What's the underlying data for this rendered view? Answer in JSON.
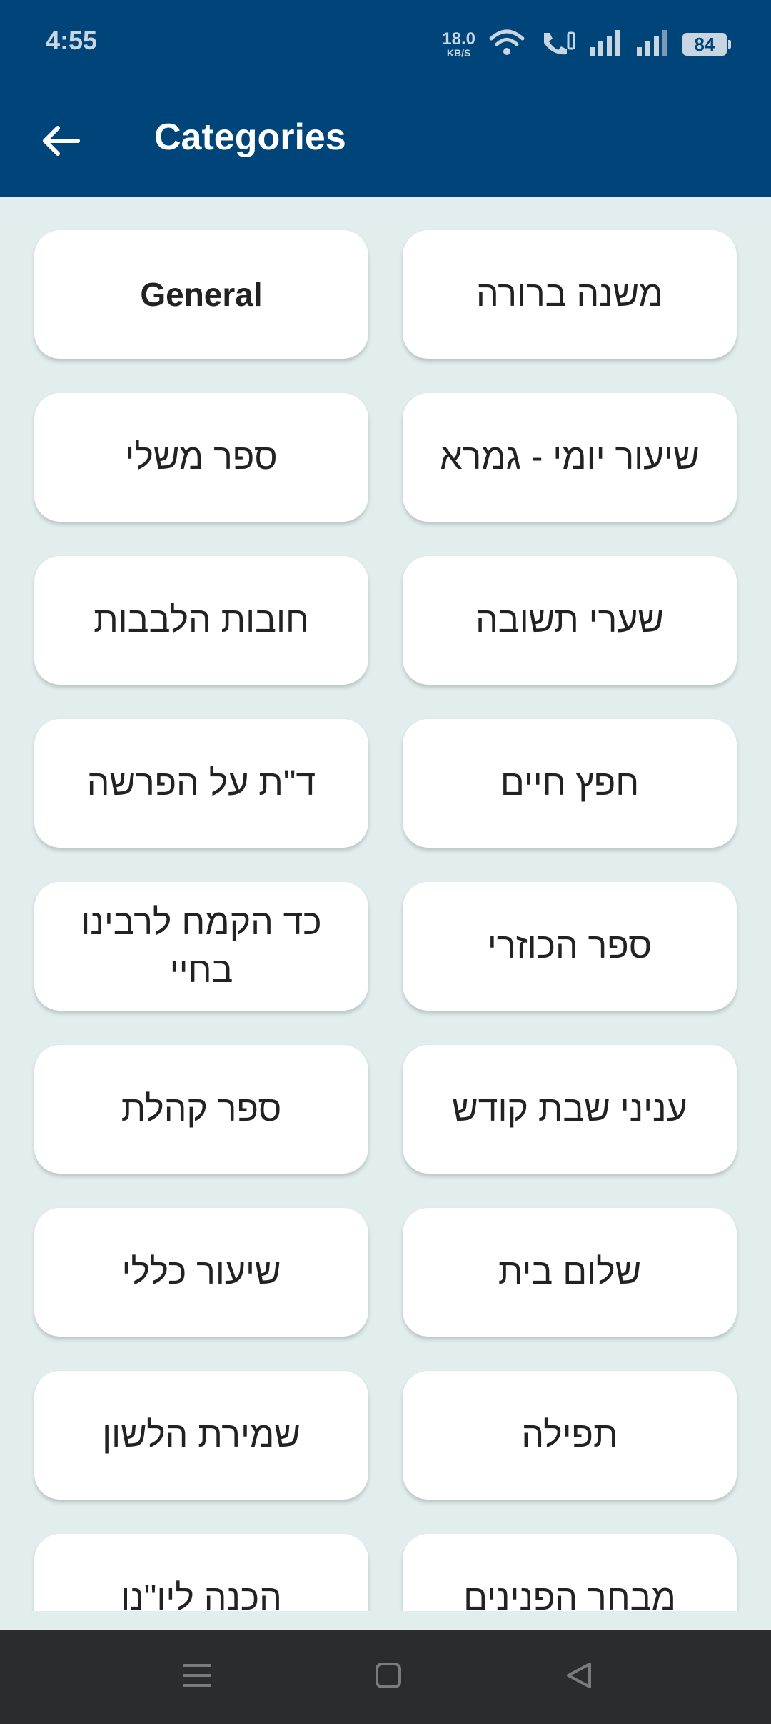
{
  "status_bar": {
    "time": "4:55",
    "net_speed_value": "18.0",
    "net_speed_unit": "KB/S",
    "battery": "84",
    "icons": [
      "wifi-icon",
      "wifi-calling-icon",
      "signal-icon",
      "signal-icon",
      "battery-icon"
    ]
  },
  "app_bar": {
    "title": "Categories",
    "back_icon": "arrow-left-icon"
  },
  "categories": [
    {
      "label": "משנה ברורה"
    },
    {
      "label": "General"
    },
    {
      "label": "שיעור יומי - גמרא"
    },
    {
      "label": "ספר משלי"
    },
    {
      "label": "שערי תשובה"
    },
    {
      "label": "חובות הלבבות"
    },
    {
      "label": "חפץ חיים"
    },
    {
      "label": "ד\"ת על הפרשה"
    },
    {
      "label": "ספר הכוזרי"
    },
    {
      "label": "כד הקמח לרבינו בחיי"
    },
    {
      "label": "עניני שבת קודש"
    },
    {
      "label": "ספר קהלת"
    },
    {
      "label": "שלום בית"
    },
    {
      "label": "שיעור כללי"
    },
    {
      "label": "תפילה"
    },
    {
      "label": "שמירת הלשון"
    },
    {
      "label": "מבחר הפנינים"
    },
    {
      "label": "הכנה ליו\"נו"
    }
  ],
  "nav_bar": {
    "buttons": [
      "menu-icon",
      "home-square-icon",
      "back-triangle-icon"
    ]
  },
  "colors": {
    "primary": "#00457a",
    "background": "#e2eeee",
    "card": "#ffffff",
    "nav": "#2b2c2e"
  }
}
